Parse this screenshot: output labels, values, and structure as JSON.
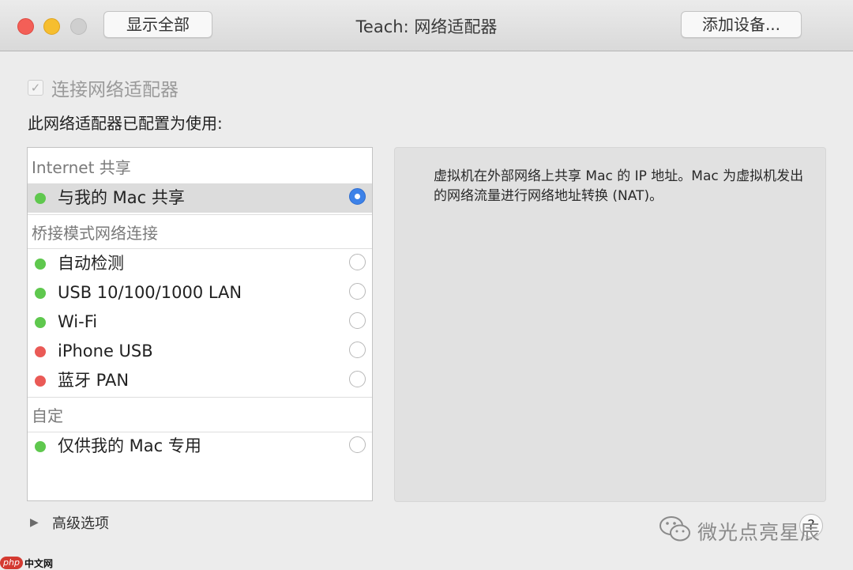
{
  "window": {
    "title": "Teach: 网络适配器",
    "show_all_label": "显示全部",
    "add_device_label": "添加设备..."
  },
  "connect": {
    "label": "连接网络适配器",
    "checked": true
  },
  "configured_label": "此网络适配器已配置为使用:",
  "list": {
    "groups": [
      {
        "title": "Internet 共享",
        "items": [
          {
            "label": "与我的 Mac 共享",
            "status": "green",
            "selected": true
          }
        ]
      },
      {
        "title": "桥接模式网络连接",
        "items": [
          {
            "label": "自动检测",
            "status": "green",
            "selected": false
          },
          {
            "label": "USB 10/100/1000 LAN",
            "status": "green",
            "selected": false
          },
          {
            "label": "Wi-Fi",
            "status": "green",
            "selected": false
          },
          {
            "label": "iPhone USB",
            "status": "red",
            "selected": false
          },
          {
            "label": "蓝牙 PAN",
            "status": "red",
            "selected": false
          }
        ]
      },
      {
        "title": "自定",
        "items": [
          {
            "label": "仅供我的 Mac 专用",
            "status": "green",
            "selected": false
          }
        ]
      }
    ]
  },
  "description": "虚拟机在外部网络上共享 Mac 的 IP 地址。Mac 为虚拟机发出的网络流量进行网络地址转换 (NAT)。",
  "advanced_label": "高级选项",
  "help_label": "?",
  "watermark": "微光点亮星辰",
  "badge": {
    "php": "php",
    "cn": "中文网"
  },
  "colors": {
    "status_green": "#5fc84e",
    "status_red": "#ea5a56",
    "radio_accent": "#3d82e8",
    "close": "#f35f57",
    "minimize": "#f6be2f"
  },
  "icons": {
    "checkbox": "checkmark-icon",
    "disclosure": "disclosure-triangle-icon",
    "watermark": "wechat-icon"
  }
}
